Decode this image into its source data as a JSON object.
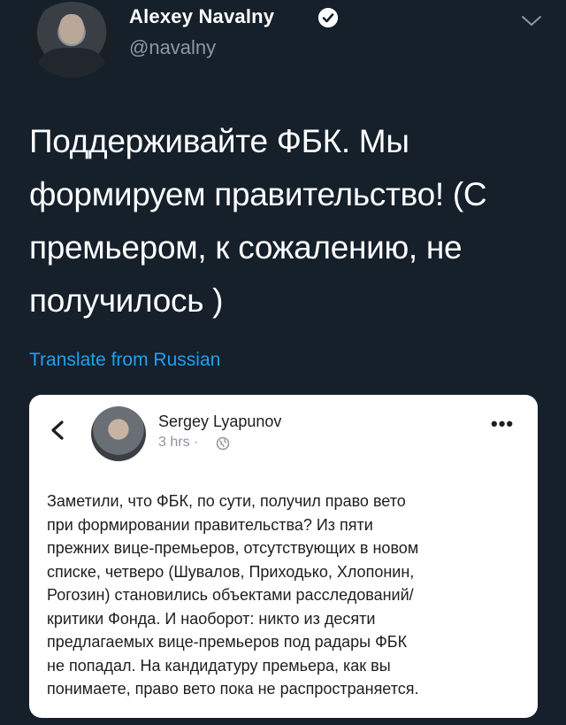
{
  "header": {
    "display_name": "Alexey Navalny",
    "handle": "@navalny",
    "icons": [
      "avatar",
      "verified-badge-icon",
      "chevron-down-icon"
    ]
  },
  "tweet": {
    "lines": [
      "Поддерживайте ФБК. Мы",
      "формируем правительство! (С",
      "премьером, к сожалению, не",
      "получилось )"
    ],
    "translate_label": "Translate from Russian"
  },
  "card": {
    "author": "Sergey Lyapunov",
    "time": "3 hrs ·",
    "icons": [
      "back-arrow-icon",
      "globe-icon",
      "more-options-icon"
    ],
    "more_label": "•••",
    "lines": [
      "Заметили, что ФБК, по сути, получил право вето",
      "при формировании правительства? Из пяти",
      "прежних вице-премьеров, отсутствующих в новом",
      "списке, четверо (Шувалов, Приходько, Хлопонин,",
      "Рогозин) становились объектами расследований/",
      "критики Фонда. И наоборот: никто из десяти",
      "предлагаемых вице-премьеров под радары ФБК",
      "не попадал. На кандидатуру премьера, как вы",
      "понимаете, право вето пока не распространяется."
    ]
  },
  "colors": {
    "background": "#15202b",
    "link": "#1da1f2",
    "muted": "#8899a6",
    "verified": "#1da1f2"
  }
}
